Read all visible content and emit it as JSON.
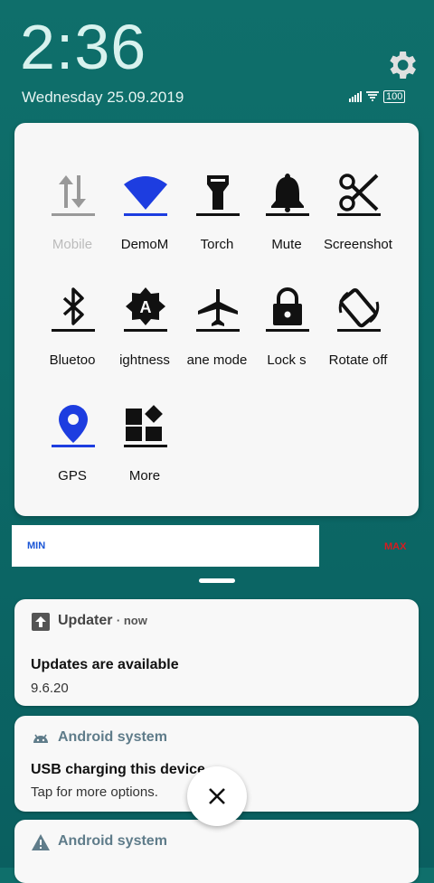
{
  "status": {
    "time": "2:36",
    "date": "Wednesday 25.09.2019",
    "battery": "100"
  },
  "quick_settings": {
    "tiles": [
      {
        "label": "Mobile",
        "icon": "mobile-data-icon",
        "state": "off"
      },
      {
        "label": "DemoM",
        "icon": "wifi-icon",
        "state": "on"
      },
      {
        "label": "Torch",
        "icon": "torch-icon",
        "state": "off"
      },
      {
        "label": "Mute",
        "icon": "bell-icon",
        "state": "off"
      },
      {
        "label": "Screenshot",
        "icon": "scissors-icon",
        "state": "off"
      },
      {
        "label": "Bluetoo",
        "icon": "bluetooth-icon",
        "state": "off"
      },
      {
        "label": "ightness",
        "icon": "auto-brightness-icon",
        "state": "off"
      },
      {
        "label": "ane mode",
        "icon": "airplane-icon",
        "state": "off"
      },
      {
        "label": "Lock s",
        "icon": "lock-icon",
        "state": "off"
      },
      {
        "label": "Rotate off",
        "icon": "rotate-icon",
        "state": "off"
      },
      {
        "label": "GPS",
        "icon": "location-pin-icon",
        "state": "on"
      },
      {
        "label": "More",
        "icon": "more-grid-icon",
        "state": "off"
      }
    ]
  },
  "brightness": {
    "min_label": "MIN",
    "max_label": "MAX",
    "level": 0.73
  },
  "notifications": [
    {
      "app": "Updater",
      "time": "now",
      "title": "Updates are available",
      "body": "9.6.20",
      "icon": "arrow-up-icon"
    },
    {
      "app": "Android system",
      "title": "USB charging this device",
      "body": "Tap for more options.",
      "icon": "android-icon"
    },
    {
      "app": "Android system",
      "icon": "warning-icon"
    }
  ],
  "colors": {
    "accent_blue": "#1d3de0",
    "min_blue": "#1a55d6",
    "max_red": "#d81b20",
    "android_gray": "#5f7c8a"
  }
}
